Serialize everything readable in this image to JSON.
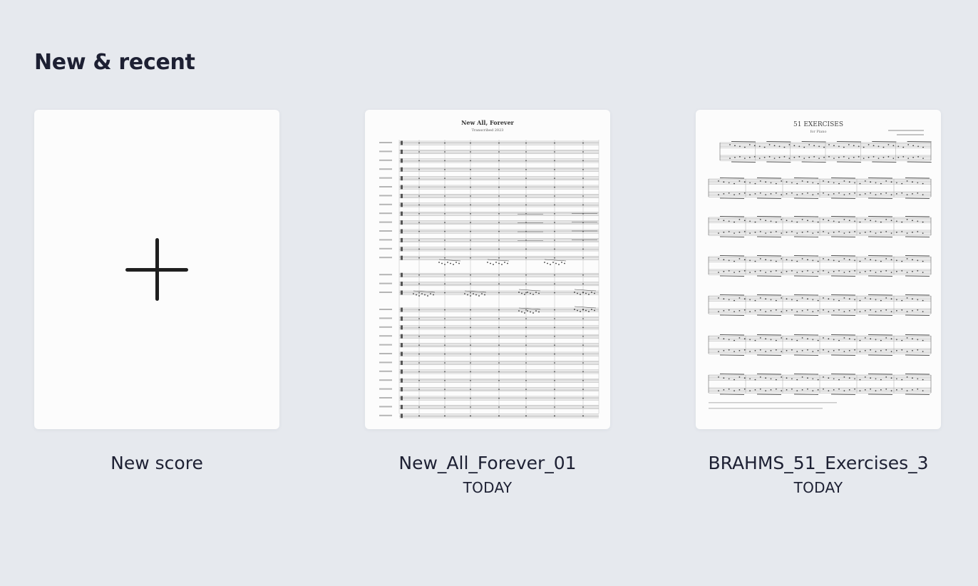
{
  "section": {
    "title": "New & recent"
  },
  "scores": [
    {
      "name": "New score",
      "date": "",
      "kind": "new",
      "icon": "plus-icon"
    },
    {
      "name": "New_All_Forever_01",
      "date": "TODAY",
      "kind": "existing",
      "thumbnail_title": "New All, Forever",
      "thumbnail_subtitle": "Transcribed 2023"
    },
    {
      "name": "BRAHMS_51_Exercises_3",
      "date": "TODAY",
      "kind": "existing",
      "thumbnail_title": "51 EXERCISES",
      "thumbnail_subtitle": "for Piano"
    }
  ],
  "colors": {
    "background": "#e6e9ee",
    "card": "#fcfcfc",
    "text": "#1d2033"
  }
}
